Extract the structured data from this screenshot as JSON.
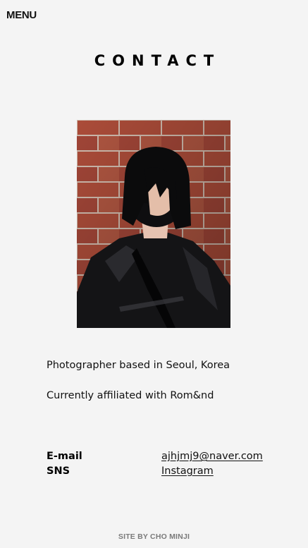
{
  "nav": {
    "menu_label": "MENU"
  },
  "page": {
    "title": "CONTACT"
  },
  "bio": {
    "line1": "Photographer based in Seoul, Korea",
    "line2": "Currently affiliated with Rom&nd"
  },
  "contact": [
    {
      "label": "E-mail",
      "value": "ajhjmj9@naver.com"
    },
    {
      "label": "SNS",
      "value": "Instagram"
    }
  ],
  "footer": {
    "credit": "SITE BY CHO MINJI"
  },
  "colors": {
    "background": "#f4f4f4",
    "text": "#111111",
    "footer_text": "#7a7a7a",
    "brick": "#b5533f",
    "mortar": "#d7c2b4"
  }
}
